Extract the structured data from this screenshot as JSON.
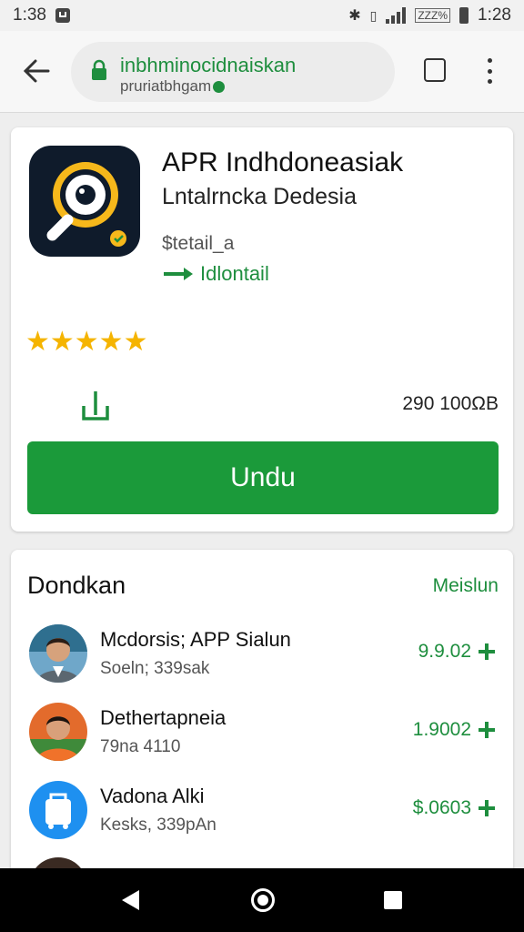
{
  "status_bar": {
    "time_left": "1:38",
    "time_right": "1:28",
    "indicator_text": "ZZZ%"
  },
  "browser": {
    "url_main": "inbhminocidnaiskan",
    "url_sub": "pruriatbhgam",
    "tab_count": ""
  },
  "app": {
    "title": "APR Indhdoneasiak",
    "subtitle": "Lntalrncka Dedesia",
    "detail": "$tetail_a",
    "tag": "Idlontail",
    "stars": "★★★★★",
    "size": "290 100ΩB",
    "install_label": "Undu"
  },
  "list": {
    "title": "Dondkan",
    "more_label": "Meislun",
    "items": [
      {
        "name": "Mcdorsis; APP Sialun",
        "meta": "Soeln; 339sak",
        "price": "9.9.02"
      },
      {
        "name": "Dethertapneia",
        "meta": "79na 4110",
        "price": "1.9002"
      },
      {
        "name": "Vadona Alki",
        "meta": "Kesks, 339pAn",
        "price": "$.0603"
      }
    ]
  },
  "colors": {
    "accent_green": "#1b9a3a",
    "link_green": "#1e8e3e",
    "star": "#f5b400"
  }
}
